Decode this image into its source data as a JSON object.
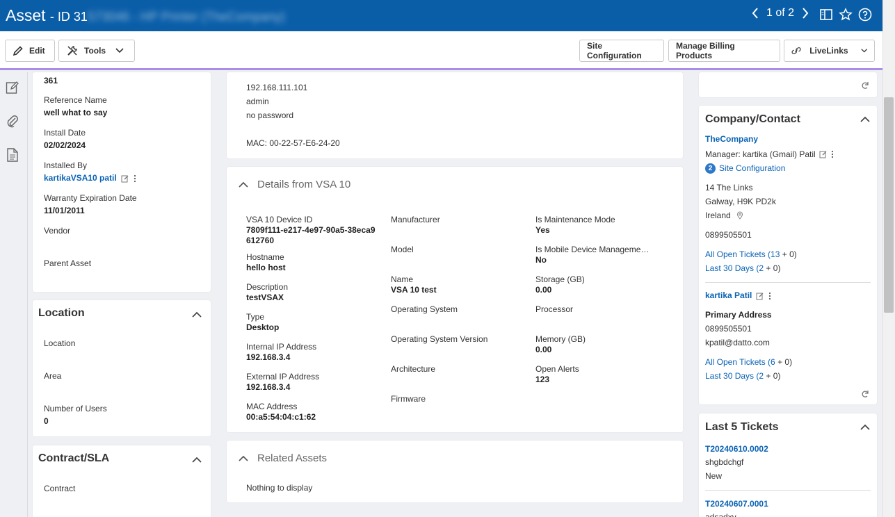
{
  "window": {
    "title": "Asset",
    "id_prefix": "- ID 31",
    "id_blurred": "573046 - HP Printer (TheCompany)",
    "pager": "1 of 2"
  },
  "toolbar": {
    "edit": "Edit",
    "tools": "Tools",
    "site_configuration": "Site Configuration",
    "manage_billing_products": "Manage Billing Products",
    "livelinks": "LiveLinks"
  },
  "asset_card": {
    "top_value": "361",
    "fields": [
      {
        "label": "Reference Name",
        "value": "well what to say"
      },
      {
        "label": "Install Date",
        "value": "02/02/2024"
      },
      {
        "label": "Installed By",
        "value": "kartikaVSA10 patil"
      },
      {
        "label": "Warranty Expiration Date",
        "value": "11/01/2011"
      },
      {
        "label": "Vendor",
        "value": ""
      },
      {
        "label": "Parent Asset",
        "value": ""
      }
    ]
  },
  "location_card": {
    "title": "Location",
    "fields": [
      {
        "label": "Location",
        "value": ""
      },
      {
        "label": "Area",
        "value": ""
      },
      {
        "label": "Number of Users",
        "value": "0"
      }
    ]
  },
  "contract_card": {
    "title": "Contract/SLA",
    "fields": [
      {
        "label": "Contract",
        "value": ""
      }
    ]
  },
  "notes": {
    "lines": [
      "192.168.111.101",
      "admin",
      "no password",
      "",
      "MAC: 00-22-57-E6-24-20"
    ]
  },
  "vsa": {
    "title": "Details from VSA 10",
    "col1": [
      {
        "label": "VSA 10 Device ID",
        "value": "7809f111-e217-4e97-90a5-38eca9612760"
      },
      {
        "label": "Hostname",
        "value": "hello host"
      },
      {
        "label": "Description",
        "value": "testVSAX"
      },
      {
        "label": "Type",
        "value": "Desktop"
      },
      {
        "label": "Internal IP Address",
        "value": "192.168.3.4"
      },
      {
        "label": "External IP Address",
        "value": "192.168.3.4"
      },
      {
        "label": "MAC Address",
        "value": "00:a5:54:04:c1:62"
      }
    ],
    "col2": [
      {
        "label": "Manufacturer",
        "value": ""
      },
      {
        "label": "Model",
        "value": ""
      },
      {
        "label": "Name",
        "value": "VSA 10 test"
      },
      {
        "label": "Operating System",
        "value": ""
      },
      {
        "label": "Operating System Version",
        "value": ""
      },
      {
        "label": "Architecture",
        "value": ""
      },
      {
        "label": "Firmware",
        "value": ""
      }
    ],
    "col3": [
      {
        "label": "Is Maintenance Mode",
        "value": "Yes"
      },
      {
        "label": "Is Mobile Device Manageme…",
        "value": "No"
      },
      {
        "label": "Storage (GB)",
        "value": "0.00"
      },
      {
        "label": "Processor",
        "value": ""
      },
      {
        "label": "Memory (GB)",
        "value": "0.00"
      },
      {
        "label": "Open Alerts",
        "value": "123"
      }
    ]
  },
  "related": {
    "title": "Related Assets",
    "empty": "Nothing to display"
  },
  "company": {
    "title": "Company/Contact",
    "name": "TheCompany",
    "manager": "Manager: kartika (Gmail) Patil",
    "site_badge": "2",
    "site_link": "Site Configuration",
    "addr1": "14 The Links",
    "addr2": "Galway,  H9K PD2k",
    "addr3": "Ireland",
    "phone": "0899505501",
    "open_tickets_label": "All Open Tickets",
    "open_tickets_paren_open": "(",
    "open_tickets_count": "13",
    "open_tickets_rest": "+ 0)",
    "last30_label": "Last 30 Days",
    "last30_paren_open": "(",
    "last30_count": "2",
    "last30_rest": "+ 0)",
    "contact_name": "kartika Patil",
    "primary_address": "Primary Address",
    "contact_phone": "0899505501",
    "contact_email": "kpatil@datto.com",
    "c_open_tickets_label": "All Open Tickets",
    "c_open_paren_open": "(",
    "c_open_count": "6",
    "c_open_rest": "+ 0)",
    "c_last30_label": "Last 30 Days",
    "c_last30_paren_open": "(",
    "c_last30_count": "2",
    "c_last30_rest": "+ 0)"
  },
  "tickets": {
    "title": "Last 5 Tickets",
    "items": [
      {
        "number": "T20240610.0002",
        "subject": "shgbdchgf",
        "status": "New"
      },
      {
        "number": "T20240607.0001",
        "subject": "adsadxv",
        "status": ""
      }
    ]
  }
}
